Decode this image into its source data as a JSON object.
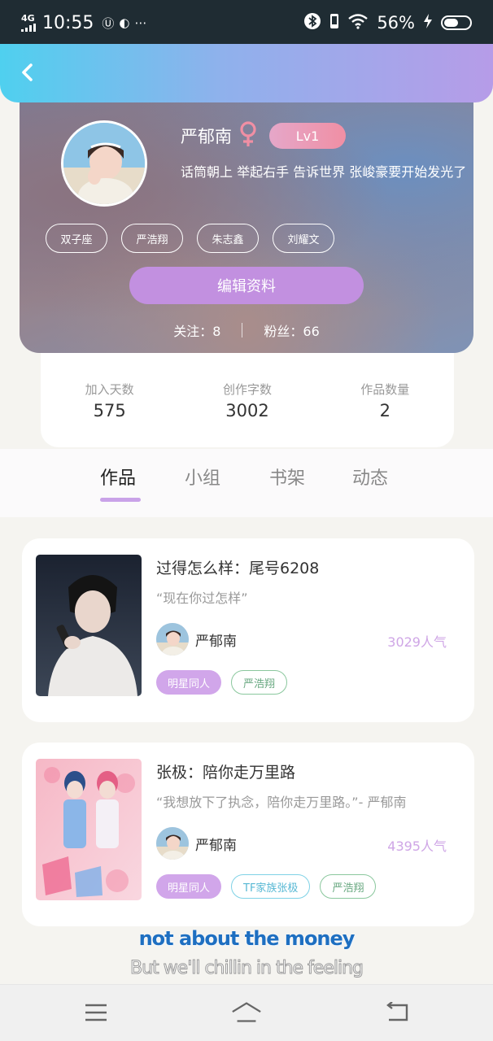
{
  "status_bar": {
    "network": "4G",
    "time": "10:55",
    "battery_percent": "56%",
    "battery_level": 0.56
  },
  "profile": {
    "username": "严郁南",
    "gender_symbol": "♀",
    "level": "Lv1",
    "bio": "话筒朝上 举起右手 告诉世界 张峻豪要开始发光了",
    "tags": [
      "双子座",
      "严浩翔",
      "朱志鑫",
      "刘耀文"
    ],
    "edit_button": "编辑资料",
    "following_label": "关注：",
    "following_count": "8",
    "fans_label": "粉丝：",
    "fans_count": "66"
  },
  "stats": [
    {
      "label": "加入天数",
      "value": "575"
    },
    {
      "label": "创作字数",
      "value": "3002"
    },
    {
      "label": "作品数量",
      "value": "2"
    }
  ],
  "tabs": [
    "作品",
    "小组",
    "书架",
    "动态"
  ],
  "active_tab": "作品",
  "works": [
    {
      "title": "过得怎么样：尾号6208",
      "quote": "“现在你过怎样”",
      "author": "严郁南",
      "popularity": "3029人气",
      "chips": [
        {
          "text": "明星同人",
          "style": "purple"
        },
        {
          "text": "严浩翔",
          "style": "green"
        }
      ]
    },
    {
      "title": "张极：陪你走万里路",
      "quote": "“我想放下了执念，陪你走万里路。”- 严郁南",
      "author": "严郁南",
      "popularity": "4395人气",
      "chips": [
        {
          "text": "明星同人",
          "style": "purple"
        },
        {
          "text": "TF家族张极",
          "style": "cyan"
        },
        {
          "text": "严浩翔",
          "style": "green"
        }
      ]
    }
  ],
  "lyrics": {
    "line1": "not about the money",
    "line2": "But we'll chillin in the feeling"
  },
  "colors": {
    "header_gradient_start": "#4fd0ef",
    "header_gradient_end": "#b69ce8",
    "accent_purple": "#c290e0",
    "popularity": "#cfa6e6",
    "tab_underline": "#c9a2e8"
  }
}
